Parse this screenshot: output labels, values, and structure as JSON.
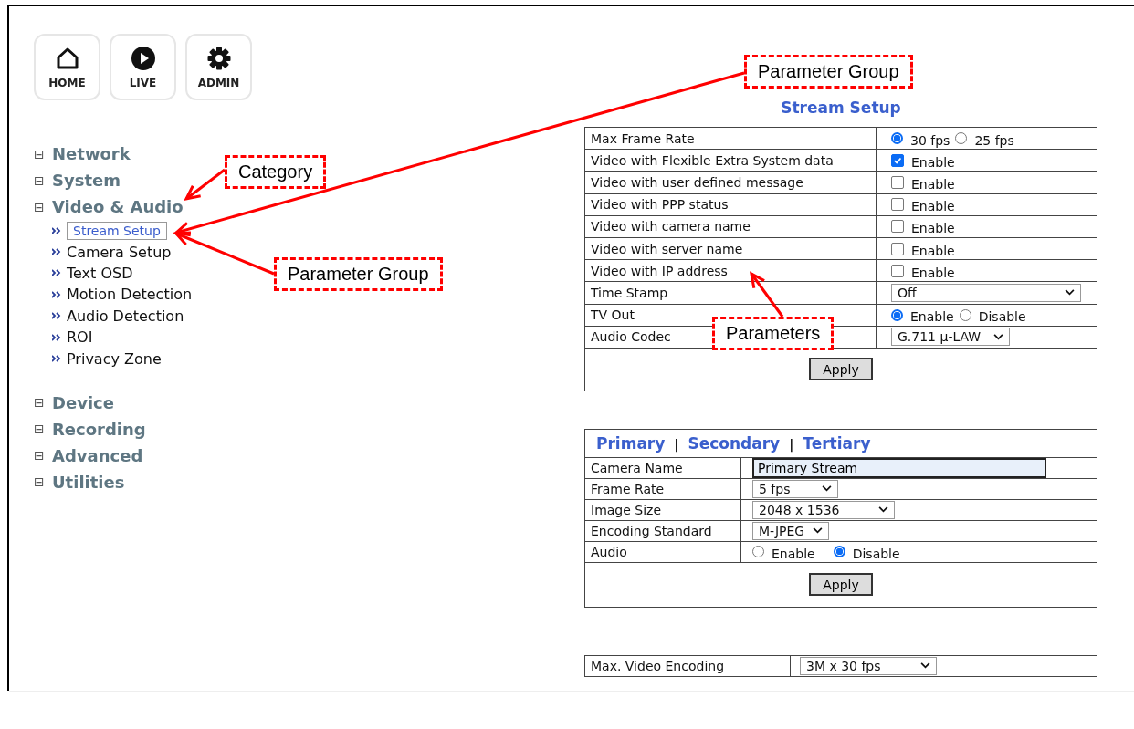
{
  "nav_buttons": [
    {
      "kind": "home",
      "label": "HOME"
    },
    {
      "kind": "live",
      "label": "LIVE"
    },
    {
      "kind": "admin",
      "label": "ADMIN"
    }
  ],
  "tree": [
    {
      "label": "Network",
      "toggle": "⊟"
    },
    {
      "label": "System",
      "toggle": "⊟"
    },
    {
      "label": "Video & Audio",
      "toggle": "⊟",
      "children": [
        {
          "label": "Stream Setup",
          "selected": true
        },
        {
          "label": "Camera Setup",
          "selected": false
        },
        {
          "label": "Text OSD",
          "selected": false
        },
        {
          "label": "Motion Detection",
          "selected": false
        },
        {
          "label": "Audio Detection",
          "selected": false
        },
        {
          "label": "ROI",
          "selected": false
        },
        {
          "label": "Privacy Zone",
          "selected": false
        }
      ]
    },
    {
      "label": "Device",
      "toggle": "⊟"
    },
    {
      "label": "Recording",
      "toggle": "⊟"
    },
    {
      "label": "Advanced",
      "toggle": "⊟"
    },
    {
      "label": "Utilities",
      "toggle": "⊟"
    }
  ],
  "stream_setup": {
    "title": "Stream Setup",
    "rows": [
      {
        "label": "Max Frame Rate",
        "kind": "radio",
        "options": [
          {
            "label": "30 fps",
            "selected": true
          },
          {
            "label": "25 fps",
            "selected": false
          }
        ]
      },
      {
        "label": "Video with Flexible Extra System data",
        "kind": "checkbox",
        "checked": true,
        "option": "Enable"
      },
      {
        "label": "Video with user defined message",
        "kind": "checkbox",
        "checked": false,
        "option": "Enable"
      },
      {
        "label": "Video with PPP status",
        "kind": "checkbox",
        "checked": false,
        "option": "Enable"
      },
      {
        "label": "Video with camera name",
        "kind": "checkbox",
        "checked": false,
        "option": "Enable"
      },
      {
        "label": "Video with server name",
        "kind": "checkbox",
        "checked": false,
        "option": "Enable"
      },
      {
        "label": "Video with IP address",
        "kind": "checkbox",
        "checked": false,
        "option": "Enable"
      },
      {
        "label": "Time Stamp",
        "kind": "select",
        "value": "Off"
      },
      {
        "label": "TV Out",
        "kind": "radio",
        "options": [
          {
            "label": "Enable",
            "selected": true
          },
          {
            "label": "Disable",
            "selected": false
          }
        ]
      },
      {
        "label": "Audio Codec",
        "kind": "select",
        "value": "G.711 μ-LAW"
      }
    ],
    "apply": "Apply"
  },
  "stream_profile": {
    "tabs": [
      {
        "label": "Primary"
      },
      {
        "label": "Secondary"
      },
      {
        "label": "Tertiary"
      }
    ],
    "separators": [
      "|",
      "|"
    ],
    "rows": [
      {
        "label": "Camera Name",
        "kind": "input",
        "value": "Primary Stream"
      },
      {
        "label": "Frame Rate",
        "kind": "select",
        "value": "5 fps"
      },
      {
        "label": "Image Size",
        "kind": "select",
        "value": "2048 x 1536"
      },
      {
        "label": "Encoding Standard",
        "kind": "select",
        "value": "M-JPEG"
      },
      {
        "label": "Audio",
        "kind": "radio",
        "options": [
          {
            "label": "Enable",
            "selected": false
          },
          {
            "label": "Disable",
            "selected": true
          }
        ]
      }
    ],
    "apply": "Apply"
  },
  "max_encoding": {
    "label": "Max. Video Encoding",
    "value": "3M x 30 fps"
  },
  "annotations": [
    "Parameter Group",
    "Category",
    "Parameter Group",
    "Parameters"
  ]
}
